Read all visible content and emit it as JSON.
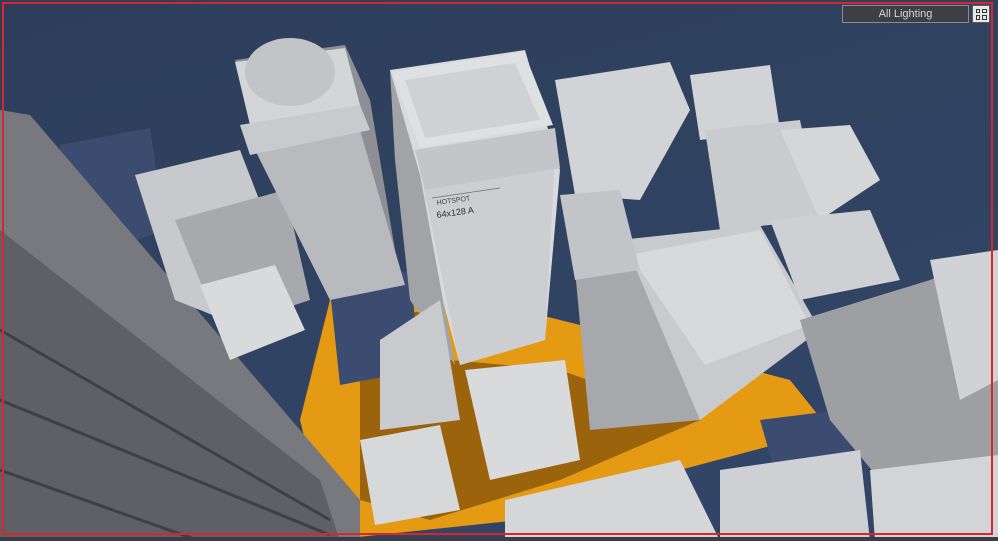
{
  "viewport": {
    "lighting_mode": "All Lighting",
    "layout_icon": "grid-2x2-icon"
  },
  "scene": {
    "building_label_top": "HOTSPOT",
    "building_label_main": "64x128 A"
  },
  "colors": {
    "sky": "#2f4260",
    "building_light": "#d9dadc",
    "building_mid": "#a9abaf",
    "building_shadow": "#3b4c70",
    "street": "#e59a13",
    "frame": "#d8262b"
  }
}
